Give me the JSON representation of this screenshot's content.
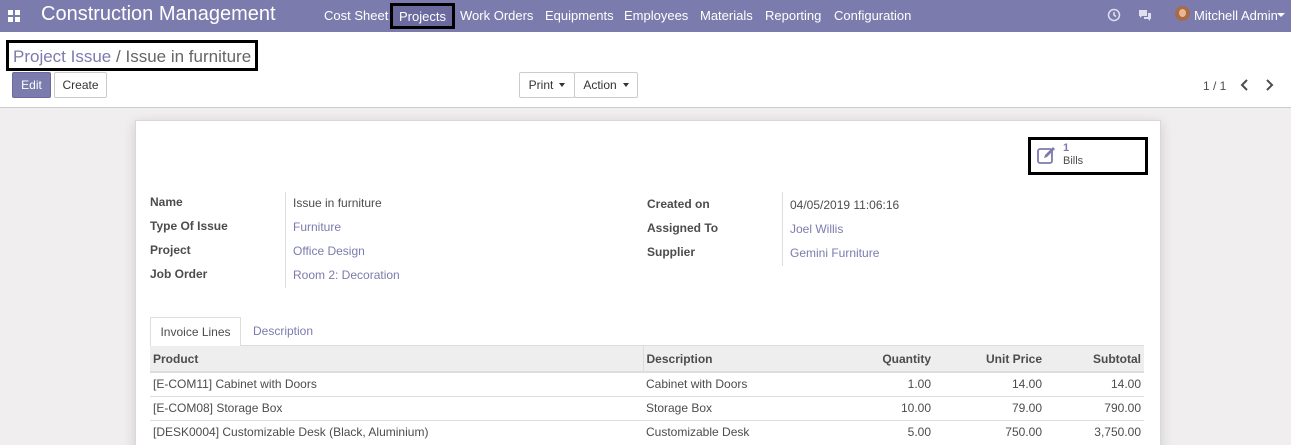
{
  "navbar": {
    "app_title": "Construction Management",
    "menu": [
      "Cost Sheet",
      "Projects",
      "Work Orders",
      "Equipments",
      "Employees",
      "Materials",
      "Reporting",
      "Configuration"
    ],
    "active_menu": "Projects",
    "user_name": "Mitchell Admin"
  },
  "breadcrumb": {
    "parent": "Project Issue",
    "separator": "/",
    "current": "Issue in furniture"
  },
  "buttons": {
    "edit": "Edit",
    "create": "Create",
    "print": "Print",
    "action": "Action"
  },
  "pager": {
    "value": "1 / 1"
  },
  "smart_button": {
    "count": "1",
    "label": "Bills"
  },
  "fields": {
    "name_label": "Name",
    "name_value": "Issue in furniture",
    "type_label": "Type Of Issue",
    "type_value": "Furniture",
    "project_label": "Project",
    "project_value": "Office Design",
    "job_order_label": "Job Order",
    "job_order_value": "Room 2: Decoration",
    "created_label": "Created on",
    "created_value": "04/05/2019 11:06:16",
    "assigned_label": "Assigned To",
    "assigned_value": "Joel Willis",
    "supplier_label": "Supplier",
    "supplier_value": "Gemini Furniture"
  },
  "tabs": {
    "invoice_lines": "Invoice Lines",
    "description": "Description"
  },
  "invoice_lines": {
    "headers": [
      "Product",
      "Description",
      "Quantity",
      "Unit Price",
      "Subtotal"
    ],
    "rows": [
      [
        "[E-COM11] Cabinet with Doors",
        "Cabinet with Doors",
        "1.00",
        "14.00",
        "14.00"
      ],
      [
        "[E-COM08] Storage Box",
        "Storage Box",
        "10.00",
        "79.00",
        "790.00"
      ],
      [
        "[DESK0004] Customizable Desk (Black, Aluminium)",
        "Customizable Desk",
        "5.00",
        "750.00",
        "3,750.00"
      ]
    ]
  },
  "colors": {
    "brand": "#7c7bad",
    "text": "#4c4c4c",
    "background": "#f0eeee"
  },
  "icons": [
    "apps-grid-icon",
    "clock-icon",
    "chat-icon",
    "caret-down-icon",
    "chevron-left-icon",
    "chevron-right-icon",
    "pencil-square-icon"
  ]
}
